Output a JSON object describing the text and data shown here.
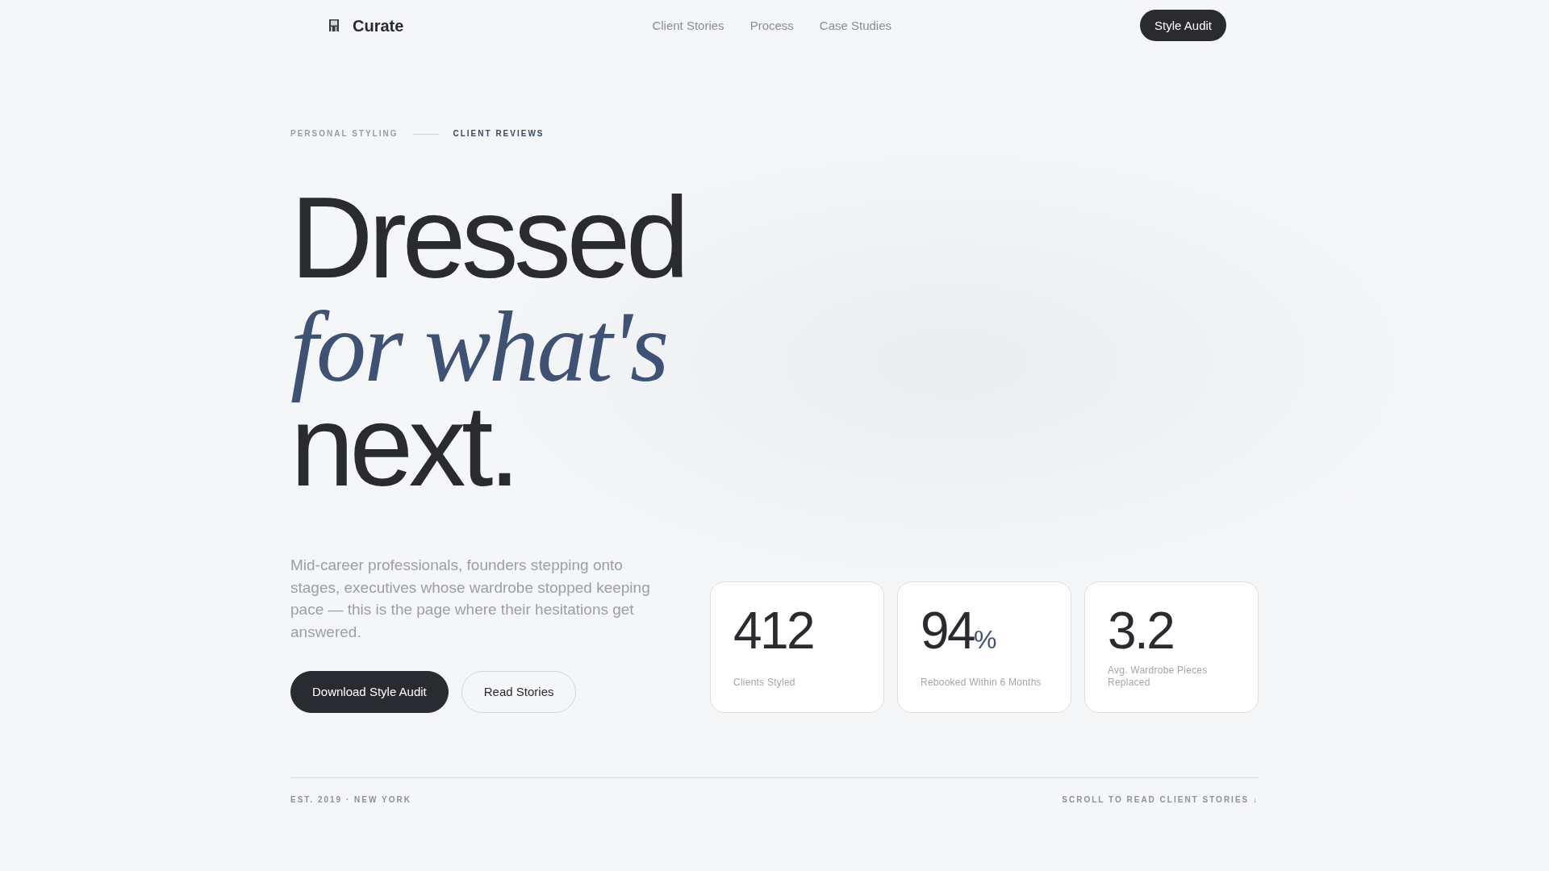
{
  "nav": {
    "brand": "Curate",
    "links": [
      "Client Stories",
      "Process",
      "Case Studies"
    ],
    "cta": "Style Audit"
  },
  "hero": {
    "eyebrow": {
      "category": "PERSONAL STYLING",
      "current": "CLIENT REVIEWS"
    },
    "headline": "Dressed *for what's* next.",
    "intro": "Mid-career professionals, founders stepping onto stages, executives whose wardrobe stopped keeping pace — this is the page where their hesitations get answered.",
    "buttons": [
      {
        "label": "Download Style Audit",
        "kind": "primary"
      },
      {
        "label": "Read Stories",
        "kind": "secondary"
      }
    ],
    "stats": [
      {
        "value": "412",
        "label": "Clients Styled"
      },
      {
        "value": "94",
        "suffix": "%",
        "label": "Rebooked Within 6 Months"
      },
      {
        "value": "3.2",
        "label": "Avg. Wardrobe Pieces Replaced"
      }
    ]
  },
  "footer": {
    "note": "EST. 2019 · NEW YORK",
    "scroll_hint": "SCROLL TO READ CLIENT STORIES ↓"
  }
}
